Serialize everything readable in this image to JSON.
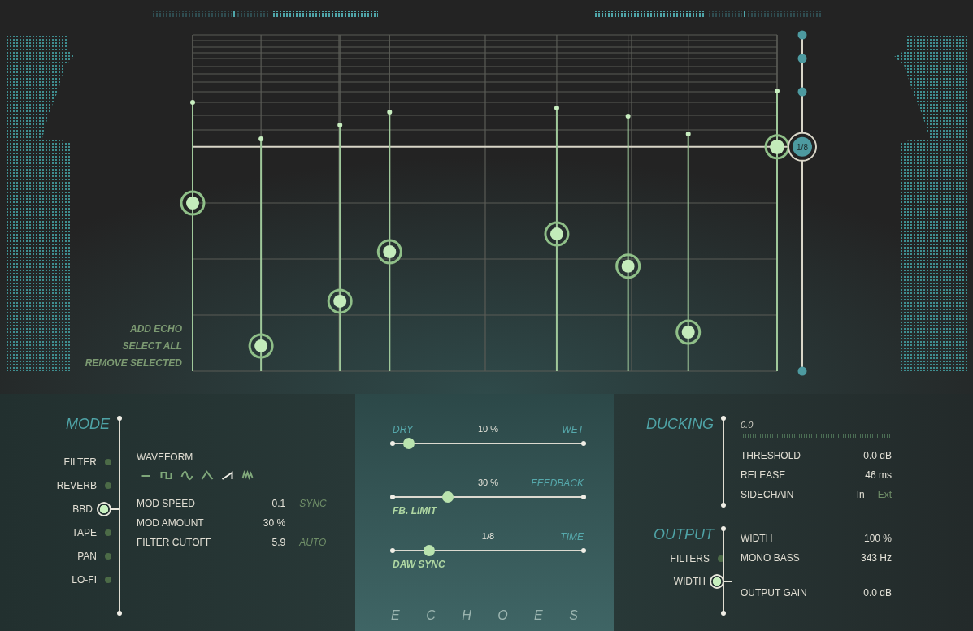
{
  "echo_menu": [
    "ADD ECHO",
    "SELECT ALL",
    "REMOVE SELECTED"
  ],
  "echoes": [
    {
      "level": 0.5
    },
    {
      "level": 0.075
    },
    {
      "level": 0.208
    },
    {
      "level": 0.355
    },
    {
      "level": 0.408
    },
    {
      "level": 0.312
    },
    {
      "level": 0.116
    },
    {
      "level": 0.667
    }
  ],
  "time_handle": {
    "label": "1/8",
    "level": 0.667
  },
  "mode": {
    "title": "MODE",
    "items": [
      {
        "label": "FILTER",
        "selected": false
      },
      {
        "label": "REVERB",
        "selected": false
      },
      {
        "label": "BBD",
        "selected": true
      },
      {
        "label": "TAPE",
        "selected": false
      },
      {
        "label": "PAN",
        "selected": false
      },
      {
        "label": "LO-FI",
        "selected": false
      }
    ],
    "waveform": {
      "label": "WAVEFORM",
      "shapes": [
        {
          "kind": "flat",
          "selected": false
        },
        {
          "kind": "square",
          "selected": false
        },
        {
          "kind": "sine",
          "selected": false
        },
        {
          "kind": "triangle",
          "selected": false
        },
        {
          "kind": "saw",
          "selected": true
        },
        {
          "kind": "random",
          "selected": false
        }
      ]
    },
    "params": [
      {
        "label": "MOD SPEED",
        "value": "0.1",
        "option": "SYNC"
      },
      {
        "label": "MOD AMOUNT",
        "value": "30 %"
      },
      {
        "label": "FILTER CUTOFF",
        "value": "5.9",
        "option": "AUTO"
      }
    ]
  },
  "mix": {
    "sliders": [
      {
        "left": "DRY",
        "value": "10 %",
        "right": "WET",
        "level": 0.085
      },
      {
        "value": "30 %",
        "right": "FEEDBACK",
        "below": "FB. LIMIT",
        "level": 0.29
      },
      {
        "value": "1/8",
        "right": "TIME",
        "below": "DAW SYNC",
        "level": 0.19
      }
    ],
    "logo": "E C H O E S"
  },
  "ducking": {
    "title": "DUCKING",
    "reading": "0.0",
    "params": [
      {
        "label": "THRESHOLD",
        "value": "0.0 dB"
      },
      {
        "label": "RELEASE",
        "value": "46 ms"
      }
    ],
    "sidechain": {
      "label": "SIDECHAIN",
      "options": [
        {
          "label": "In",
          "selected": true
        },
        {
          "label": "Ext",
          "selected": false
        }
      ]
    }
  },
  "output": {
    "title": "OUTPUT",
    "items": [
      {
        "label": "FILTERS",
        "selected": false
      },
      {
        "label": "WIDTH",
        "selected": true
      }
    ],
    "params": [
      {
        "label": "WIDTH",
        "value": "100 %"
      },
      {
        "label": "MONO BASS",
        "value": "343 Hz"
      }
    ],
    "gain": {
      "label": "OUTPUT GAIN",
      "value": "0.0 dB"
    }
  }
}
